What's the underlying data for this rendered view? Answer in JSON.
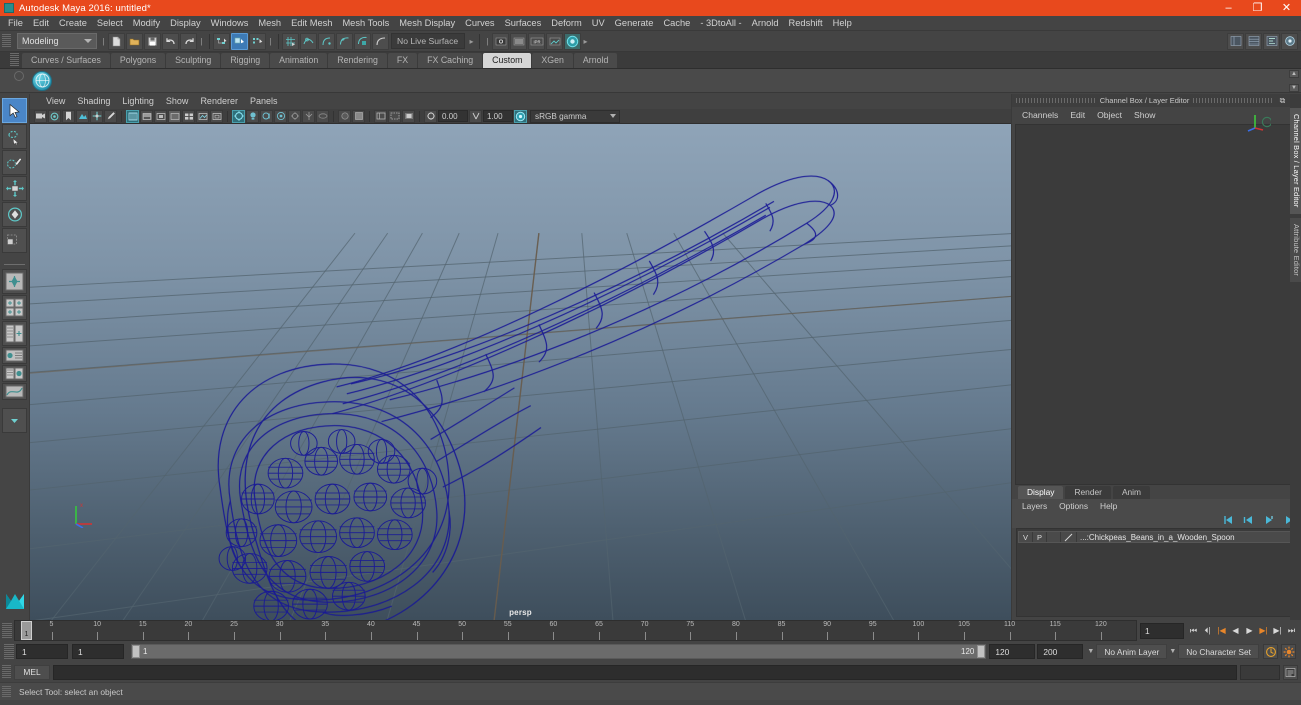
{
  "window": {
    "title": "Autodesk Maya 2016: untitled*",
    "app_icon": "maya-icon",
    "minimize_label": "–",
    "maximize_label": "❐",
    "close_label": "✕",
    "accent_color": "#e8491d"
  },
  "menubar": {
    "items": [
      "File",
      "Edit",
      "Create",
      "Select",
      "Modify",
      "Display",
      "Windows",
      "Mesh",
      "Edit Mesh",
      "Mesh Tools",
      "Mesh Display",
      "Curves",
      "Surfaces",
      "Deform",
      "UV",
      "Generate",
      "Cache",
      "- 3DtoAll -",
      "Arnold",
      "Redshift",
      "Help"
    ]
  },
  "statusline": {
    "mode_menu": "Modeling",
    "live_surface": "No Live Surface",
    "file_icons": [
      "new-scene-icon",
      "open-scene-icon",
      "save-scene-icon",
      "undo-icon",
      "redo-icon"
    ],
    "selection_mask_icons": [
      "select-by-hierarchy-icon",
      "select-by-object-type-icon",
      "select-by-component-type-icon"
    ],
    "snap_icons": [
      "snap-to-grid-icon",
      "snap-to-curve-icon",
      "snap-to-point-icon",
      "snap-to-projected-center-icon",
      "snap-to-view-plane-icon",
      "make-live-icon"
    ],
    "render_icons": [
      "render-current-frame-icon",
      "ipr-render-icon",
      "render-settings-icon",
      "hypershade-icon",
      "render-view-icon"
    ],
    "right_icons": [
      "show-hide-editors-icon",
      "channel-box-icon",
      "attribute-editor-icon",
      "tool-settings-icon"
    ]
  },
  "shelf": {
    "tabs": [
      "Curves / Surfaces",
      "Polygons",
      "Sculpting",
      "Rigging",
      "Animation",
      "Rendering",
      "FX",
      "FX Caching",
      "Custom",
      "XGen",
      "Arnold"
    ],
    "active_tab": "Custom",
    "button_icon": "custom-shelf-sphere-icon"
  },
  "toolbox": {
    "tools": [
      {
        "name": "select-tool",
        "selected": true
      },
      {
        "name": "lasso-select-tool",
        "selected": false
      },
      {
        "name": "paint-select-tool",
        "selected": false
      },
      {
        "name": "move-tool",
        "selected": false
      },
      {
        "name": "rotate-tool",
        "selected": false
      },
      {
        "name": "scale-tool",
        "selected": false
      }
    ],
    "layouts": [
      {
        "name": "single-pane-layout"
      },
      {
        "name": "four-pane-layout"
      },
      {
        "name": "two-pane-side-layout"
      },
      {
        "name": "persp-outliner-layout"
      },
      {
        "name": "hypershade-persp-layout"
      },
      {
        "name": "persp-graph-layout"
      },
      {
        "name": "layout-presets-menu"
      }
    ],
    "logo": "maya-logo"
  },
  "viewport": {
    "menus": [
      "View",
      "Shading",
      "Lighting",
      "Show",
      "Renderer",
      "Panels"
    ],
    "camera_label": "persp",
    "exposure_value": "0.00",
    "gamma_value": "1.00",
    "color_management": "sRGB gamma",
    "toolbar_icons": [
      "select-camera-icon",
      "camera-attributes-icon",
      "bookmark-icon",
      "image-plane-icon",
      "two-d-pan-zoom-icon",
      "grease-pencil-icon",
      "wireframe-shading-icon",
      "smooth-shade-all-icon",
      "smooth-shade-selected-icon",
      "flat-shade-icon",
      "wireframe-on-shaded-icon",
      "texture-icon",
      "xray-icon",
      "use-default-lighting-icon",
      "use-all-lights-icon",
      "shadows-icon",
      "screen-space-ao-icon",
      "motion-blur-icon",
      "multisample-aa-icon",
      "depth-of-field-icon",
      "isolate-select-icon",
      "grid-toggle-icon",
      "film-gate-icon",
      "resolution-gate-icon",
      "gate-mask-icon",
      "exposure-icon",
      "gamma-icon",
      "color-management-icon"
    ],
    "model": {
      "name": "Chickpeas_Beans_in_a_Wooden_Spoon",
      "display": "wireframe",
      "wire_color": "#1a1a96"
    },
    "axis_gizmo": "axis-indicator"
  },
  "channelbox": {
    "panel_title": "Channel Box / Layer Editor",
    "undock_label": "⧉",
    "close_label": "✕",
    "menus": [
      "Channels",
      "Edit",
      "Object",
      "Show"
    ],
    "empty": true
  },
  "layer_editor": {
    "tabs": [
      "Display",
      "Render",
      "Anim"
    ],
    "active_tab": "Display",
    "menus": [
      "Layers",
      "Options",
      "Help"
    ],
    "quick_buttons": [
      "move-layer-up-icon",
      "move-layer-down-icon",
      "new-layer-icon",
      "new-layer-from-selected-icon"
    ],
    "layers": [
      {
        "visibility": "V",
        "playback": "P",
        "type": "",
        "color_swatch": "layer-color-swatch",
        "name": "...:Chickpeas_Beans_in_a_Wooden_Spoon"
      }
    ]
  },
  "side_tabs": {
    "items": [
      "Channel Box / Layer Editor",
      "Attribute Editor"
    ],
    "active": "Channel Box / Layer Editor"
  },
  "timeline": {
    "start": 1,
    "end": 120,
    "current_frame": "1",
    "tick_labels": [
      5,
      10,
      15,
      20,
      25,
      30,
      35,
      40,
      45,
      50,
      55,
      60,
      65,
      70,
      75,
      80,
      85,
      90,
      95,
      100,
      105,
      110,
      115,
      120
    ],
    "frame_field": "1",
    "playback_buttons": [
      {
        "name": "go-to-start-icon",
        "glyph": "⏮",
        "highlight": false
      },
      {
        "name": "step-back-keyframe-icon",
        "glyph": "⏴|",
        "highlight": false
      },
      {
        "name": "step-back-frame-icon",
        "glyph": "|◀",
        "highlight": true
      },
      {
        "name": "play-backwards-icon",
        "glyph": "◀",
        "highlight": false
      },
      {
        "name": "play-forwards-icon",
        "glyph": "▶",
        "highlight": false
      },
      {
        "name": "step-forward-frame-icon",
        "glyph": "▶|",
        "highlight": true
      },
      {
        "name": "step-forward-keyframe-icon",
        "glyph": "▶|",
        "highlight": false
      },
      {
        "name": "go-to-end-icon",
        "glyph": "⏭",
        "highlight": false
      }
    ]
  },
  "range_slider": {
    "anim_start": "1",
    "playback_start": "1",
    "range_left_label": "1",
    "range_right_label": "120",
    "playback_end": "120",
    "anim_end": "200",
    "anim_layer": "No Anim Layer",
    "character_set": "No Character Set",
    "auto_key_icon": "auto-keyframe-icon",
    "anim_prefs_icon": "animation-preferences-icon"
  },
  "command_line": {
    "language_label": "MEL",
    "input_value": "",
    "input_placeholder": "",
    "script_editor_icon": "script-editor-icon"
  },
  "help_line": {
    "message": "Select Tool: select an object"
  }
}
